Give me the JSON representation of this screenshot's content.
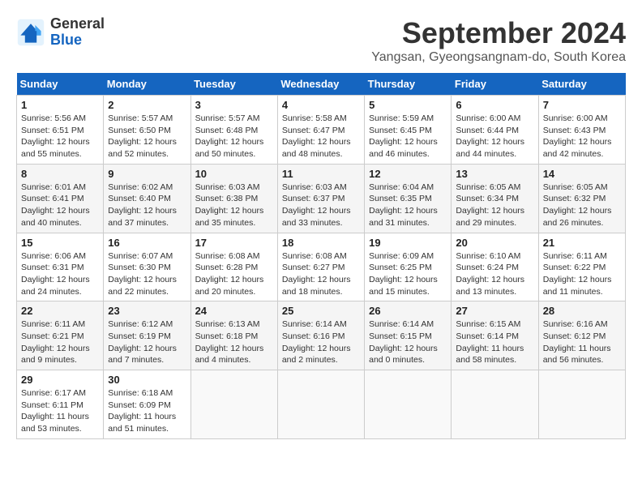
{
  "logo": {
    "line1": "General",
    "line2": "Blue"
  },
  "title": "September 2024",
  "subtitle": "Yangsan, Gyeongsangnam-do, South Korea",
  "headers": [
    "Sunday",
    "Monday",
    "Tuesday",
    "Wednesday",
    "Thursday",
    "Friday",
    "Saturday"
  ],
  "weeks": [
    [
      {
        "day": "1",
        "info": "Sunrise: 5:56 AM\nSunset: 6:51 PM\nDaylight: 12 hours\nand 55 minutes."
      },
      {
        "day": "2",
        "info": "Sunrise: 5:57 AM\nSunset: 6:50 PM\nDaylight: 12 hours\nand 52 minutes."
      },
      {
        "day": "3",
        "info": "Sunrise: 5:57 AM\nSunset: 6:48 PM\nDaylight: 12 hours\nand 50 minutes."
      },
      {
        "day": "4",
        "info": "Sunrise: 5:58 AM\nSunset: 6:47 PM\nDaylight: 12 hours\nand 48 minutes."
      },
      {
        "day": "5",
        "info": "Sunrise: 5:59 AM\nSunset: 6:45 PM\nDaylight: 12 hours\nand 46 minutes."
      },
      {
        "day": "6",
        "info": "Sunrise: 6:00 AM\nSunset: 6:44 PM\nDaylight: 12 hours\nand 44 minutes."
      },
      {
        "day": "7",
        "info": "Sunrise: 6:00 AM\nSunset: 6:43 PM\nDaylight: 12 hours\nand 42 minutes."
      }
    ],
    [
      {
        "day": "8",
        "info": "Sunrise: 6:01 AM\nSunset: 6:41 PM\nDaylight: 12 hours\nand 40 minutes."
      },
      {
        "day": "9",
        "info": "Sunrise: 6:02 AM\nSunset: 6:40 PM\nDaylight: 12 hours\nand 37 minutes."
      },
      {
        "day": "10",
        "info": "Sunrise: 6:03 AM\nSunset: 6:38 PM\nDaylight: 12 hours\nand 35 minutes."
      },
      {
        "day": "11",
        "info": "Sunrise: 6:03 AM\nSunset: 6:37 PM\nDaylight: 12 hours\nand 33 minutes."
      },
      {
        "day": "12",
        "info": "Sunrise: 6:04 AM\nSunset: 6:35 PM\nDaylight: 12 hours\nand 31 minutes."
      },
      {
        "day": "13",
        "info": "Sunrise: 6:05 AM\nSunset: 6:34 PM\nDaylight: 12 hours\nand 29 minutes."
      },
      {
        "day": "14",
        "info": "Sunrise: 6:05 AM\nSunset: 6:32 PM\nDaylight: 12 hours\nand 26 minutes."
      }
    ],
    [
      {
        "day": "15",
        "info": "Sunrise: 6:06 AM\nSunset: 6:31 PM\nDaylight: 12 hours\nand 24 minutes."
      },
      {
        "day": "16",
        "info": "Sunrise: 6:07 AM\nSunset: 6:30 PM\nDaylight: 12 hours\nand 22 minutes."
      },
      {
        "day": "17",
        "info": "Sunrise: 6:08 AM\nSunset: 6:28 PM\nDaylight: 12 hours\nand 20 minutes."
      },
      {
        "day": "18",
        "info": "Sunrise: 6:08 AM\nSunset: 6:27 PM\nDaylight: 12 hours\nand 18 minutes."
      },
      {
        "day": "19",
        "info": "Sunrise: 6:09 AM\nSunset: 6:25 PM\nDaylight: 12 hours\nand 15 minutes."
      },
      {
        "day": "20",
        "info": "Sunrise: 6:10 AM\nSunset: 6:24 PM\nDaylight: 12 hours\nand 13 minutes."
      },
      {
        "day": "21",
        "info": "Sunrise: 6:11 AM\nSunset: 6:22 PM\nDaylight: 12 hours\nand 11 minutes."
      }
    ],
    [
      {
        "day": "22",
        "info": "Sunrise: 6:11 AM\nSunset: 6:21 PM\nDaylight: 12 hours\nand 9 minutes."
      },
      {
        "day": "23",
        "info": "Sunrise: 6:12 AM\nSunset: 6:19 PM\nDaylight: 12 hours\nand 7 minutes."
      },
      {
        "day": "24",
        "info": "Sunrise: 6:13 AM\nSunset: 6:18 PM\nDaylight: 12 hours\nand 4 minutes."
      },
      {
        "day": "25",
        "info": "Sunrise: 6:14 AM\nSunset: 6:16 PM\nDaylight: 12 hours\nand 2 minutes."
      },
      {
        "day": "26",
        "info": "Sunrise: 6:14 AM\nSunset: 6:15 PM\nDaylight: 12 hours\nand 0 minutes."
      },
      {
        "day": "27",
        "info": "Sunrise: 6:15 AM\nSunset: 6:14 PM\nDaylight: 11 hours\nand 58 minutes."
      },
      {
        "day": "28",
        "info": "Sunrise: 6:16 AM\nSunset: 6:12 PM\nDaylight: 11 hours\nand 56 minutes."
      }
    ],
    [
      {
        "day": "29",
        "info": "Sunrise: 6:17 AM\nSunset: 6:11 PM\nDaylight: 11 hours\nand 53 minutes."
      },
      {
        "day": "30",
        "info": "Sunrise: 6:18 AM\nSunset: 6:09 PM\nDaylight: 11 hours\nand 51 minutes."
      },
      {
        "day": "",
        "info": ""
      },
      {
        "day": "",
        "info": ""
      },
      {
        "day": "",
        "info": ""
      },
      {
        "day": "",
        "info": ""
      },
      {
        "day": "",
        "info": ""
      }
    ]
  ]
}
